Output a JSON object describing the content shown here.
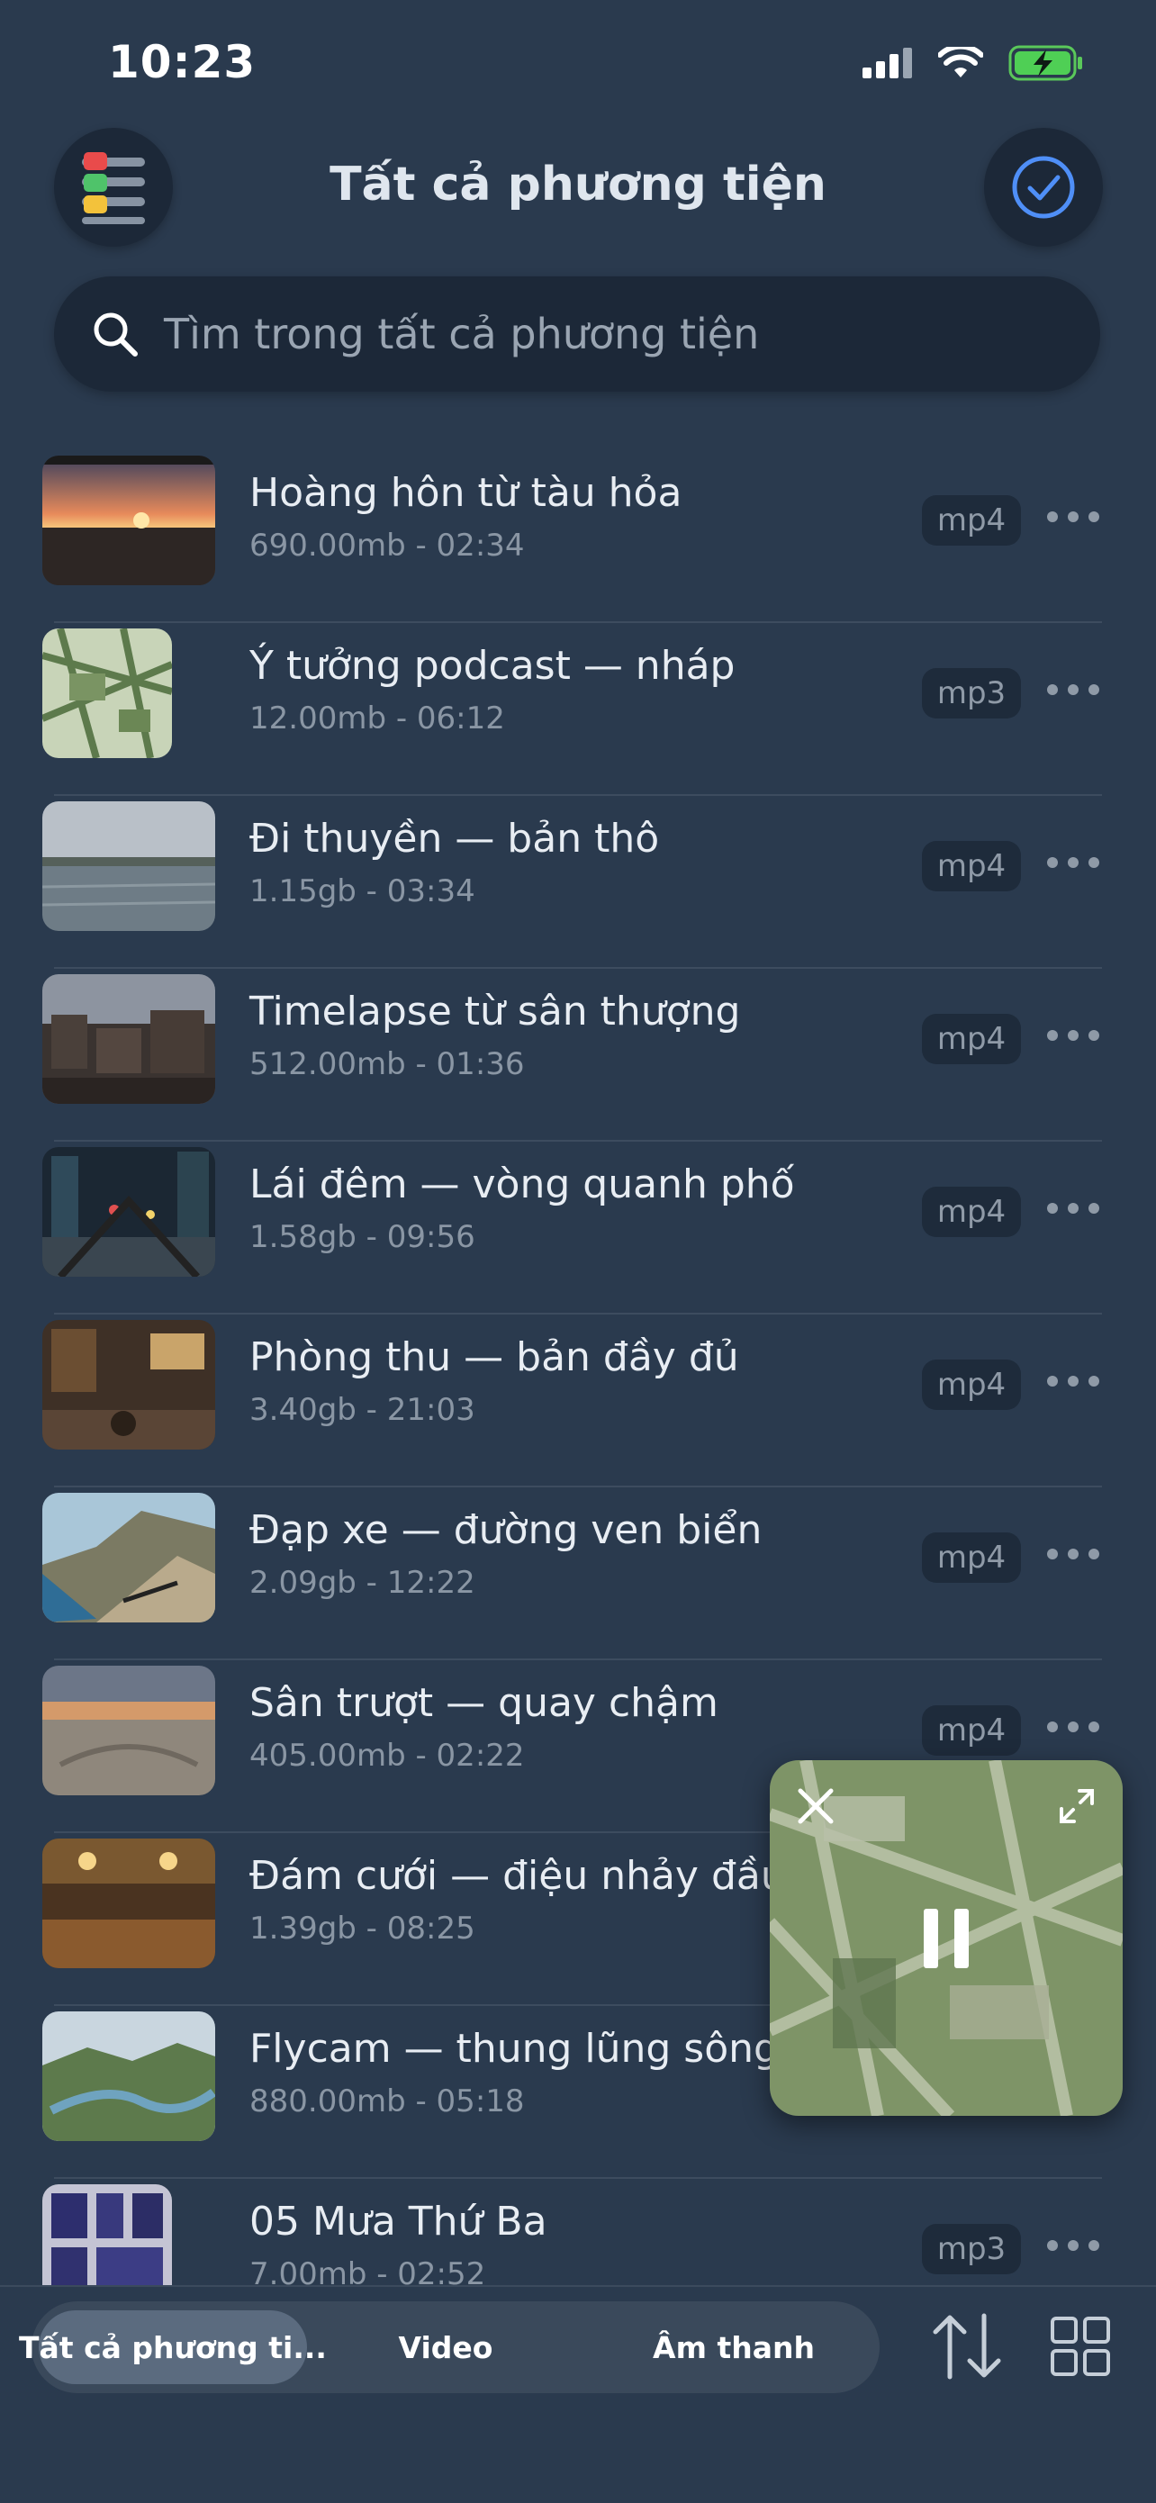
{
  "status_bar": {
    "time": "10:23",
    "icons": [
      "signal-icon",
      "wifi-icon",
      "battery-charging-icon"
    ]
  },
  "header": {
    "title": "Tất cả phương tiện",
    "left_button_icon": "filter-list-icon",
    "right_button_icon": "select-check-icon"
  },
  "search": {
    "placeholder": "Tìm trong tất cả phương tiện"
  },
  "items": [
    {
      "title": "Hoàng hôn từ tàu hỏa",
      "meta": "690.00mb - 02:34",
      "format": "mp4"
    },
    {
      "title": "Ý tưởng podcast — nháp",
      "meta": "12.00mb - 06:12",
      "format": "mp3"
    },
    {
      "title": "Đi thuyền — bản thô",
      "meta": "1.15gb - 03:34",
      "format": "mp4"
    },
    {
      "title": "Timelapse từ sân thượng",
      "meta": "512.00mb - 01:36",
      "format": "mp4"
    },
    {
      "title": "Lái đêm — vòng quanh phố",
      "meta": "1.58gb - 09:56",
      "format": "mp4"
    },
    {
      "title": "Phòng thu — bản đầy đủ",
      "meta": "3.40gb - 21:03",
      "format": "mp4"
    },
    {
      "title": "Đạp xe — đường ven biển",
      "meta": "2.09gb - 12:22",
      "format": "mp4"
    },
    {
      "title": "Sân trượt — quay chậm",
      "meta": "405.00mb - 02:22",
      "format": "mp4"
    },
    {
      "title": "Đám cưới — điệu nhảy đầu",
      "meta": "1.39gb - 08:25",
      "format": ""
    },
    {
      "title": "Flycam — thung lũng sông",
      "meta": "880.00mb - 05:18",
      "format": ""
    },
    {
      "title": "05 Mưa Thứ Ba",
      "meta": "7.00mb - 02:52",
      "format": "mp3"
    }
  ],
  "tabs": [
    {
      "label": "Tất cả phương ti...",
      "active": true
    },
    {
      "label": "Video",
      "active": false
    },
    {
      "label": "Âm thanh",
      "active": false
    }
  ],
  "toolbar": {
    "sort_icon": "sort-arrows-icon",
    "grid_icon": "grid-view-icon"
  },
  "mini_player": {
    "state": "playing",
    "icons": [
      "close-icon",
      "expand-icon",
      "pause-icon"
    ]
  },
  "colors": {
    "background": "#2a3a4e",
    "surface": "#1c2838",
    "accent": "#4f8ff7"
  }
}
